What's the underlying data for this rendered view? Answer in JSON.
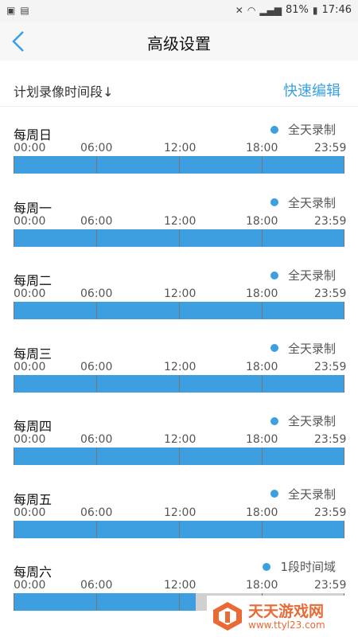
{
  "status_bar": {
    "battery": "81%",
    "time": "17:46"
  },
  "header": {
    "title": "高级设置",
    "back_icon": "back-arrow-icon"
  },
  "plan": {
    "label": "计划录像时间段↓",
    "quick_edit": "快速编辑"
  },
  "ticks": [
    "00:00",
    "06:00",
    "12:00",
    "18:00",
    "23:59"
  ],
  "days": [
    {
      "name": "每周日",
      "mode": "全天录制",
      "fill_fraction": 1.0
    },
    {
      "name": "每周一",
      "mode": "全天录制",
      "fill_fraction": 1.0
    },
    {
      "name": "每周二",
      "mode": "全天录制",
      "fill_fraction": 1.0
    },
    {
      "name": "每周三",
      "mode": "全天录制",
      "fill_fraction": 1.0
    },
    {
      "name": "每周四",
      "mode": "全天录制",
      "fill_fraction": 1.0
    },
    {
      "name": "每周五",
      "mode": "全天录制",
      "fill_fraction": 1.0
    },
    {
      "name": "每周六",
      "mode": "1段时间域",
      "fill_fraction": 0.55
    }
  ],
  "colors": {
    "accent": "#3d9fe0",
    "track": "#d0d0d0"
  },
  "watermark": {
    "title": "天天游戏网",
    "url": "www.ttyl23.com"
  }
}
